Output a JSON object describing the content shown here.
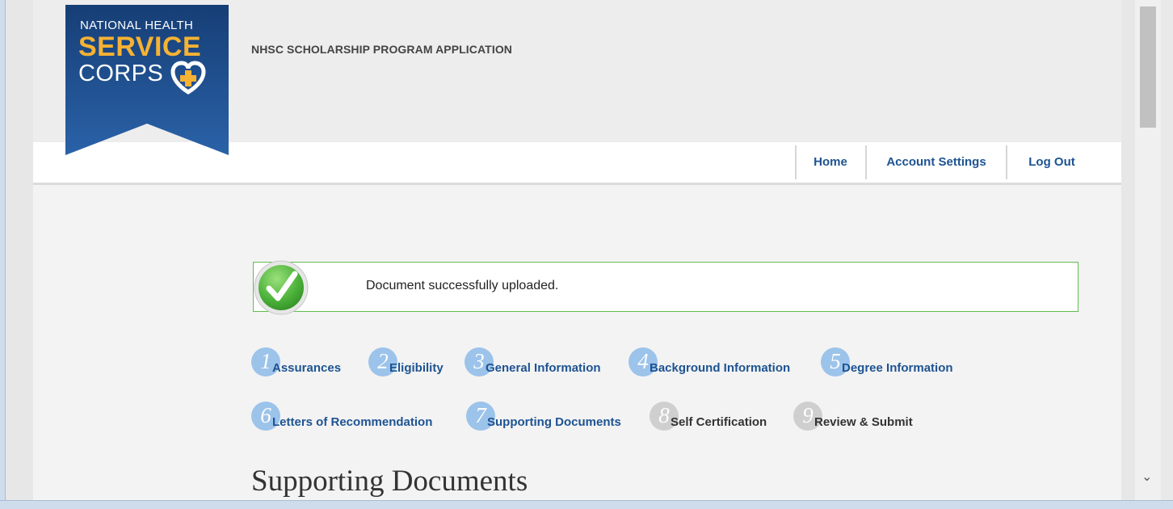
{
  "header": {
    "logo": {
      "line1": "NATIONAL HEALTH",
      "line2": "SERVICE",
      "line3": "CORPS"
    },
    "app_title": "NHSC SCHOLARSHIP PROGRAM APPLICATION"
  },
  "nav": {
    "home": "Home",
    "account_settings": "Account Settings",
    "log_out": "Log Out"
  },
  "alert": {
    "message": "Document successfully uploaded.",
    "icon": "checkmark-icon"
  },
  "steps": [
    {
      "number": "1",
      "label": "Assurances",
      "enabled": true
    },
    {
      "number": "2",
      "label": "Eligibility",
      "enabled": true
    },
    {
      "number": "3",
      "label": "General Information",
      "enabled": true
    },
    {
      "number": "4",
      "label": "Background Information",
      "enabled": true
    },
    {
      "number": "5",
      "label": "Degree Information",
      "enabled": true
    },
    {
      "number": "6",
      "label": "Letters of Recommendation",
      "enabled": true
    },
    {
      "number": "7",
      "label": "Supporting Documents",
      "enabled": true
    },
    {
      "number": "8",
      "label": "Self Certification",
      "enabled": false
    },
    {
      "number": "9",
      "label": "Review & Submit",
      "enabled": false
    }
  ],
  "section_title": "Supporting Documents",
  "colors": {
    "brand_blue": "#1d5392",
    "logo_blue": "#1f4f8f",
    "logo_orange": "#f6b233",
    "step_active": "#9cc3ea",
    "step_inactive": "#cfcfcf",
    "success_border": "#61bd4f"
  }
}
